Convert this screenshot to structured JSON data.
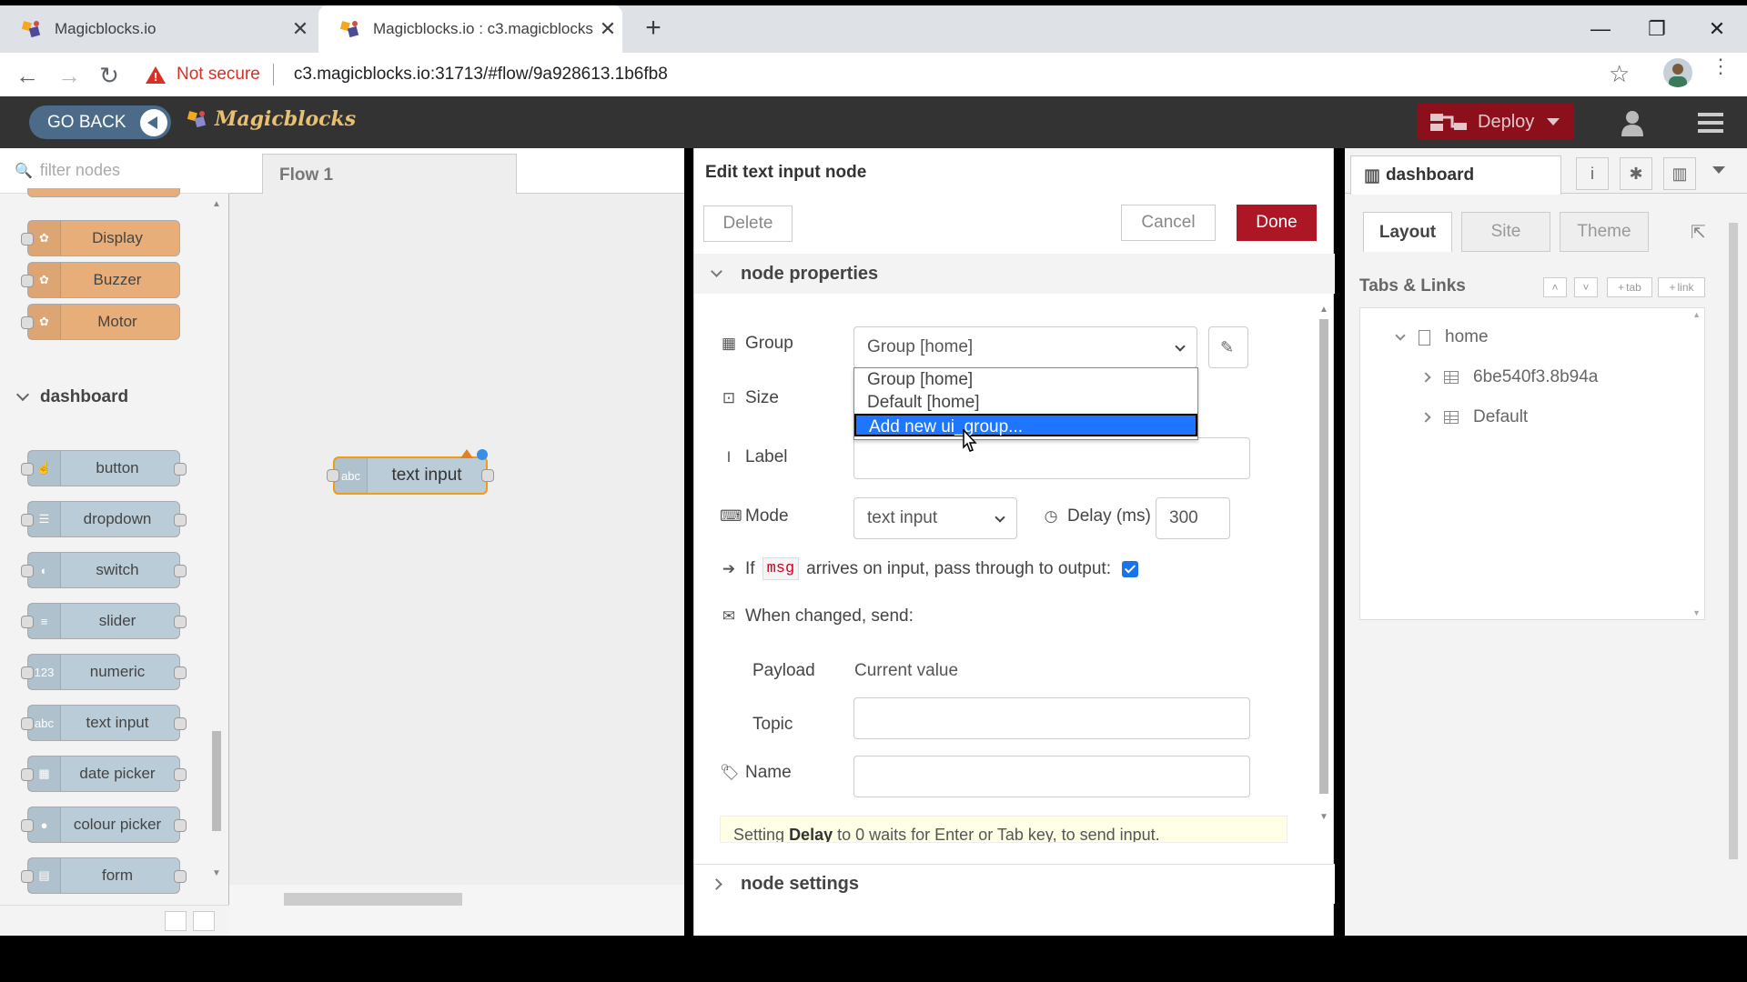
{
  "browser": {
    "tabs": [
      {
        "title": "Magicblocks.io",
        "active": false
      },
      {
        "title": "Magicblocks.io : c3.magicblocks.io",
        "active": true
      }
    ],
    "security_label": "Not secure",
    "url": "c3.magicblocks.io:31713/#flow/9a928613.1b6fb8"
  },
  "header": {
    "go_back_label": "GO BACK",
    "brand": "Magicblocks",
    "deploy_label": "Deploy"
  },
  "palette": {
    "filter_placeholder": "filter nodes",
    "top_nodes": [
      {
        "label": "Display"
      },
      {
        "label": "Buzzer"
      },
      {
        "label": "Motor"
      }
    ],
    "category": "dashboard",
    "dashboard_nodes": [
      {
        "label": "button"
      },
      {
        "label": "dropdown"
      },
      {
        "label": "switch"
      },
      {
        "label": "slider"
      },
      {
        "label": "numeric",
        "icon": "123"
      },
      {
        "label": "text input",
        "icon": "abc"
      },
      {
        "label": "date picker"
      },
      {
        "label": "colour picker"
      },
      {
        "label": "form"
      }
    ]
  },
  "workspace": {
    "flow_tab": "Flow 1",
    "node_label": "text input",
    "node_icon": "abc"
  },
  "editor": {
    "title": "Edit text input node",
    "delete_label": "Delete",
    "cancel_label": "Cancel",
    "done_label": "Done",
    "section_properties": "node properties",
    "section_settings": "node settings",
    "group_label": "Group",
    "group_value": "Group [home]",
    "group_options": [
      "Group [home]",
      "Default [home]",
      "Add new ui_group..."
    ],
    "size_label": "Size",
    "label_label": "Label",
    "label_value": "",
    "mode_label": "Mode",
    "mode_value": "text input",
    "delay_label": "Delay (ms)",
    "delay_value": "300",
    "passthrough_if": "If",
    "passthrough_msg": "msg",
    "passthrough_text": "arrives on input, pass through to output:",
    "passthrough_checked": true,
    "when_changed_label": "When changed, send:",
    "payload_label": "Payload",
    "payload_value": "Current value",
    "topic_label": "Topic",
    "topic_value": "",
    "name_label": "Name",
    "name_value": "",
    "tip_prefix": "Setting",
    "tip_bold": "Delay",
    "tip_suffix": "to 0 waits for Enter or Tab key, to send input."
  },
  "sidebar": {
    "tab_label": "dashboard",
    "subtabs": [
      "Layout",
      "Site",
      "Theme"
    ],
    "tabs_links_label": "Tabs & Links",
    "tab_btn": "tab",
    "link_btn": "link",
    "tree": [
      {
        "label": "home",
        "level": 0,
        "expanded": true,
        "kind": "tab"
      },
      {
        "label": "6be540f3.8b94a",
        "level": 1,
        "expanded": false,
        "kind": "group"
      },
      {
        "label": "Default",
        "level": 1,
        "expanded": false,
        "kind": "group"
      }
    ]
  }
}
